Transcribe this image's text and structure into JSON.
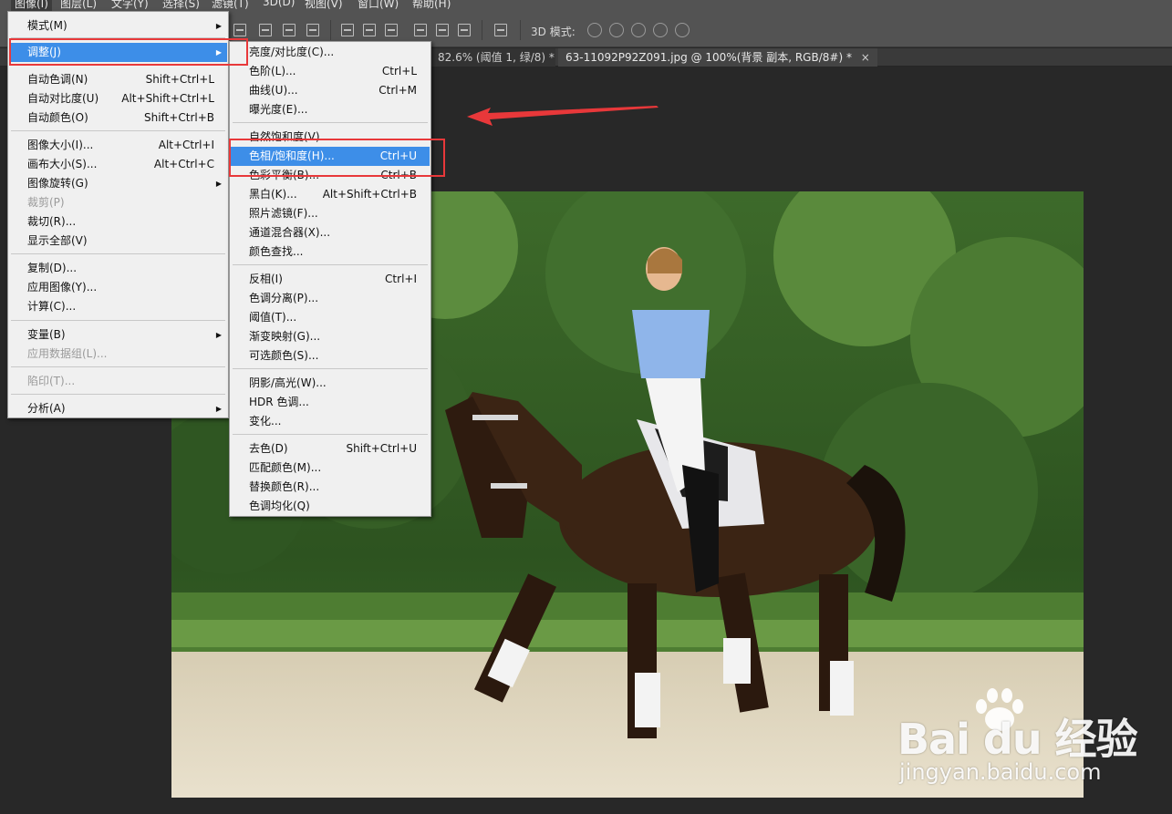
{
  "menubar": {
    "items": [
      "图像(I)",
      "图层(L)",
      "文字(Y)",
      "选择(S)",
      "滤镜(T)",
      "3D(D)",
      "视图(V)",
      "窗口(W)",
      "帮助(H)"
    ]
  },
  "optionsbar": {
    "mode_label": "3D 模式:"
  },
  "tabs": [
    {
      "label": "82.6% (阈值 1, 绿/8) *"
    },
    {
      "label": "63-11092P92Z091.jpg @ 100%(背景 副本, RGB/8#) *",
      "close": "×"
    }
  ],
  "image_menu": {
    "items": [
      {
        "label": "模式(M)",
        "submenu": true
      },
      {
        "label": "调整(J)",
        "submenu": true,
        "highlighted": true
      },
      {
        "label": "自动色调(N)",
        "shortcut": "Shift+Ctrl+L"
      },
      {
        "label": "自动对比度(U)",
        "shortcut": "Alt+Shift+Ctrl+L"
      },
      {
        "label": "自动颜色(O)",
        "shortcut": "Shift+Ctrl+B"
      },
      {
        "label": "图像大小(I)...",
        "shortcut": "Alt+Ctrl+I"
      },
      {
        "label": "画布大小(S)...",
        "shortcut": "Alt+Ctrl+C"
      },
      {
        "label": "图像旋转(G)",
        "submenu": true
      },
      {
        "label": "裁剪(P)",
        "disabled": true
      },
      {
        "label": "裁切(R)..."
      },
      {
        "label": "显示全部(V)"
      },
      {
        "label": "复制(D)..."
      },
      {
        "label": "应用图像(Y)..."
      },
      {
        "label": "计算(C)..."
      },
      {
        "label": "变量(B)",
        "submenu": true
      },
      {
        "label": "应用数据组(L)...",
        "disabled": true
      },
      {
        "label": "陷印(T)...",
        "disabled": true
      },
      {
        "label": "分析(A)",
        "submenu": true
      }
    ]
  },
  "adjust_menu": {
    "items": [
      {
        "label": "亮度/对比度(C)..."
      },
      {
        "label": "色阶(L)...",
        "shortcut": "Ctrl+L"
      },
      {
        "label": "曲线(U)...",
        "shortcut": "Ctrl+M"
      },
      {
        "label": "曝光度(E)..."
      },
      {
        "label": "自然饱和度(V)..."
      },
      {
        "label": "色相/饱和度(H)...",
        "shortcut": "Ctrl+U",
        "highlighted": true
      },
      {
        "label": "色彩平衡(B)...",
        "shortcut": "Ctrl+B"
      },
      {
        "label": "黑白(K)...",
        "shortcut": "Alt+Shift+Ctrl+B"
      },
      {
        "label": "照片滤镜(F)..."
      },
      {
        "label": "通道混合器(X)..."
      },
      {
        "label": "颜色查找..."
      },
      {
        "label": "反相(I)",
        "shortcut": "Ctrl+I"
      },
      {
        "label": "色调分离(P)..."
      },
      {
        "label": "阈值(T)..."
      },
      {
        "label": "渐变映射(G)..."
      },
      {
        "label": "可选颜色(S)..."
      },
      {
        "label": "阴影/高光(W)..."
      },
      {
        "label": "HDR 色调..."
      },
      {
        "label": "变化..."
      },
      {
        "label": "去色(D)",
        "shortcut": "Shift+Ctrl+U"
      },
      {
        "label": "匹配颜色(M)..."
      },
      {
        "label": "替换颜色(R)..."
      },
      {
        "label": "色调均化(Q)"
      }
    ]
  },
  "watermark": {
    "brand": "Bai du 经验",
    "url": "jingyan.baidu.com"
  },
  "colors": {
    "highlight": "#3d8ee8",
    "annotation": "#e8383a",
    "menu_bg": "#f0f0f0",
    "app_bg": "#282828"
  },
  "icons": [
    "submenu-arrow-icon",
    "align-icon",
    "3d-mode-icon",
    "tab-close-icon",
    "baidu-paw-icon"
  ]
}
